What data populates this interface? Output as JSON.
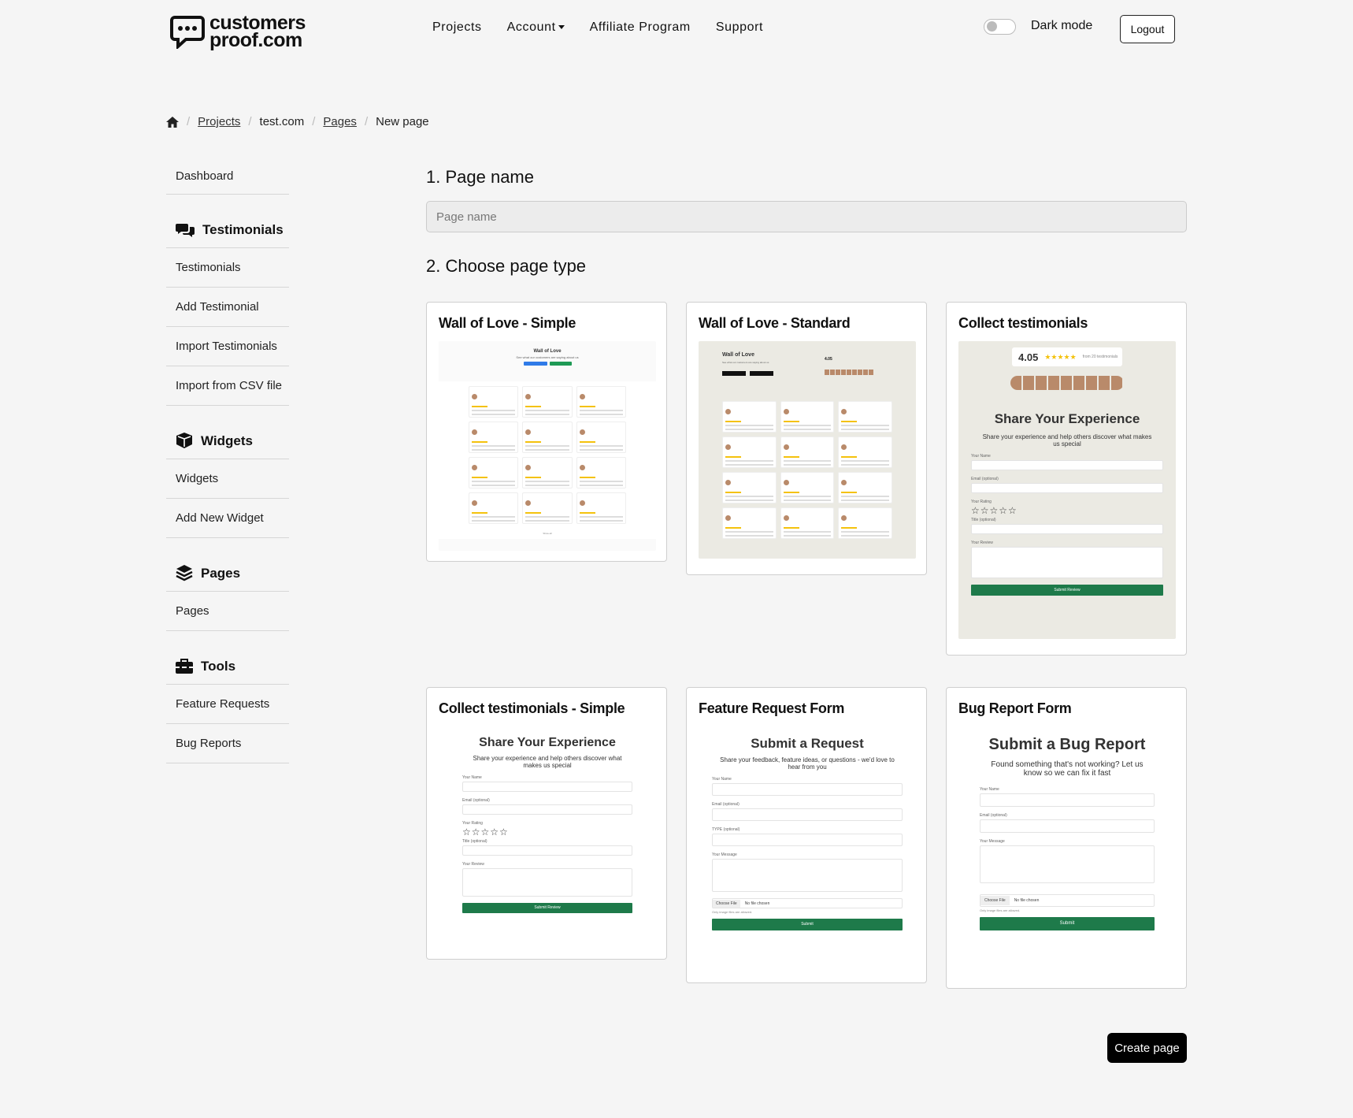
{
  "brand": {
    "name_line1": "customers",
    "name_line2": "proof.com"
  },
  "nav": {
    "projects": "Projects",
    "account": "Account",
    "affiliate": "Affiliate Program",
    "support": "Support",
    "dark_mode_label": "Dark mode",
    "dark_mode_on": false,
    "logout": "Logout"
  },
  "breadcrumb": {
    "projects": "Projects",
    "project": "test.com",
    "pages": "Pages",
    "current": "New page"
  },
  "sidebar": {
    "dashboard": "Dashboard",
    "testimonials_head": "Testimonials",
    "testimonials": "Testimonials",
    "add_testimonial": "Add Testimonial",
    "import_testimonials": "Import Testimonials",
    "import_csv": "Import from CSV file",
    "widgets_head": "Widgets",
    "widgets": "Widgets",
    "add_widget": "Add New Widget",
    "pages_head": "Pages",
    "pages": "Pages",
    "tools_head": "Tools",
    "feature_requests": "Feature Requests",
    "bug_reports": "Bug Reports"
  },
  "form": {
    "step1": "1. Page name",
    "page_name_placeholder": "Page name",
    "page_name_value": "",
    "step2": "2. Choose page type",
    "create": "Create page"
  },
  "page_types": [
    {
      "title": "Wall of Love - Simple",
      "preview": {
        "heading": "Wall of Love",
        "sub": "See what our customers are saying about us",
        "footer": "Show all"
      }
    },
    {
      "title": "Wall of Love - Standard",
      "preview": {
        "heading": "Wall of Love",
        "sub": "See what our customers are saying about us",
        "rating": "4.05"
      }
    },
    {
      "title": "Collect testimonials",
      "preview": {
        "rating": "4.05",
        "from": "from 20 testimonials",
        "heading": "Share Your Experience",
        "sub": "Share your experience and help others discover what makes us special",
        "name": "Your Name",
        "email": "Email (optional)",
        "rating_label": "Your Rating",
        "title_label": "Title (optional)",
        "review": "Your Review",
        "button": "Submit Review"
      }
    },
    {
      "title": "Collect testimonials - Simple",
      "preview": {
        "heading": "Share Your Experience",
        "sub": "Share your experience and help others discover what makes us special",
        "name": "Your Name",
        "email": "Email (optional)",
        "rating_label": "Your Rating",
        "title_label": "Title (optional)",
        "review": "Your Review",
        "button": "Submit Review"
      }
    },
    {
      "title": "Feature Request Form",
      "preview": {
        "heading": "Submit a Request",
        "sub": "Share your feedback, feature ideas, or questions - we'd love to hear from you",
        "name": "Your Name",
        "email": "Email (optional)",
        "type": "TYPE (optional)",
        "message": "Your Message",
        "file_btn": "Choose File",
        "file_none": "No file chosen",
        "file_note": "Only image files are allowed.",
        "button": "Submit"
      }
    },
    {
      "title": "Bug Report Form",
      "preview": {
        "heading": "Submit a Bug Report",
        "sub": "Found something that's not working? Let us know so we can fix it fast",
        "name": "Your Name",
        "email": "Email (optional)",
        "message": "Your Message",
        "file_btn": "Choose File",
        "file_none": "No file chosen",
        "file_note": "Only image files are allowed.",
        "button": "Submit"
      }
    }
  ]
}
